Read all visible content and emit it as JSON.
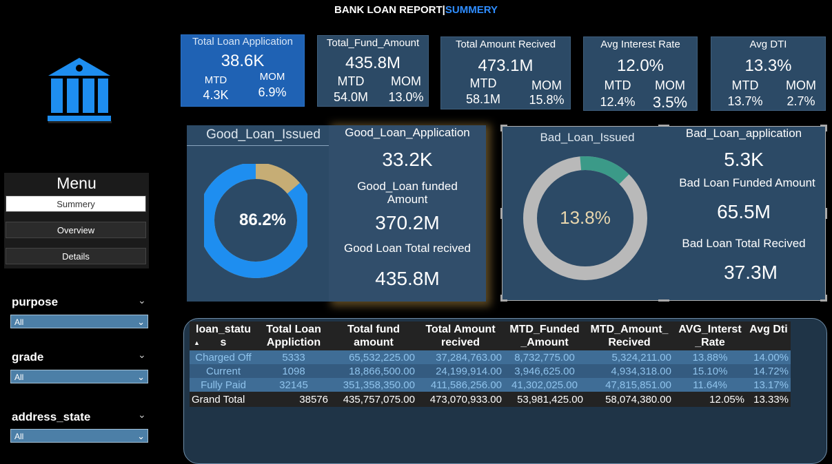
{
  "header": {
    "title_main": "BANK LOAN REPORT|",
    "title_accent": "SUMMERY"
  },
  "colors": {
    "accent": "#2f8dff",
    "card_blue": "#1f62b4",
    "card_dark": "#2c4a66",
    "gold_text": "#c9b07c",
    "good_donut": "#1e8ef0",
    "good_donut_rest": "#c6ad75",
    "bad_donut": "#3b9a88",
    "bad_donut_rest": "#b9b9b9"
  },
  "logo": {
    "icon": "bank-icon"
  },
  "kpis": [
    {
      "title": "Total Loan Application",
      "value": "38.6K",
      "mtd_label": "MTD",
      "mom_label": "MOM",
      "mtd": "4.3K",
      "mom": "6.9%"
    },
    {
      "title": "Total_Fund_Amount",
      "value": "435.8M",
      "mtd_label": "MTD",
      "mom_label": "MOM",
      "mtd": "54.0M",
      "mom": "13.0%"
    },
    {
      "title": "Total Amount Recived",
      "value": "473.1M",
      "mtd_label": "MTD",
      "mom_label": "MOM",
      "mtd": "58.1M",
      "mom": "15.8%"
    },
    {
      "title": "Avg Interest Rate",
      "value": "12.0%",
      "mtd_label": "MTD",
      "mom_label": "MOM",
      "mtd": "12.4%",
      "mom": "3.5%"
    },
    {
      "title": "Avg DTI",
      "value": "13.3%",
      "mtd_label": "MTD",
      "mom_label": "MOM",
      "mtd": "13.7%",
      "mom": "2.7%"
    }
  ],
  "menu": {
    "title": "Menu",
    "items": [
      "Summery",
      "Overview",
      "Details"
    ]
  },
  "filters": [
    {
      "label": "purpose",
      "value": "All"
    },
    {
      "label": "grade",
      "value": "All"
    },
    {
      "label": "address_state",
      "value": "All"
    }
  ],
  "good_loan": {
    "title": "Good_Loan_Issued",
    "percent_label": "86.2%",
    "percent": 86.2,
    "application_label": "Good_Loan_Application",
    "application_value": "33.2K",
    "funded_label_1": "Good_Loan funded",
    "funded_label_2": "Amount",
    "funded_value": "370.2M",
    "received_label": "Good Loan Total recived",
    "received_value": "435.8M"
  },
  "bad_loan": {
    "title": "Bad_Loan_Issued",
    "percent_label": "13.8%",
    "percent": 13.8,
    "application_label": "Bad_Loan_application",
    "application_value": "5.3K",
    "funded_label": "Bad Loan Funded Amount",
    "funded_value": "65.5M",
    "received_label": "Bad Loan Total Recived",
    "received_value": "37.3M"
  },
  "table": {
    "headers": [
      "loan_status",
      "Total Loan Appliction",
      "Total fund amount",
      "Total Amount recived",
      "MTD_Funded _Amount",
      "MTD_Amount_ Recived",
      "AVG_Interst _Rate",
      "Avg Dti"
    ],
    "rows": [
      [
        "Charged Off",
        "5333",
        "65,532,225.00",
        "37,284,763.00",
        "8,732,775.00",
        "5,324,211.00",
        "13.88%",
        "14.00%"
      ],
      [
        "Current",
        "1098",
        "18,866,500.00",
        "24,199,914.00",
        "3,946,625.00",
        "4,934,318.00",
        "15.10%",
        "14.72%"
      ],
      [
        "Fully Paid",
        "32145",
        "351,358,350.00",
        "411,586,256.00",
        "41,302,025.00",
        "47,815,851.00",
        "11.64%",
        "13.17%"
      ]
    ],
    "total": [
      "Grand Total",
      "38576",
      "435,757,075.00",
      "473,070,933.00",
      "53,981,425.00",
      "58,074,380.00",
      "12.05%",
      "13.33%"
    ]
  }
}
